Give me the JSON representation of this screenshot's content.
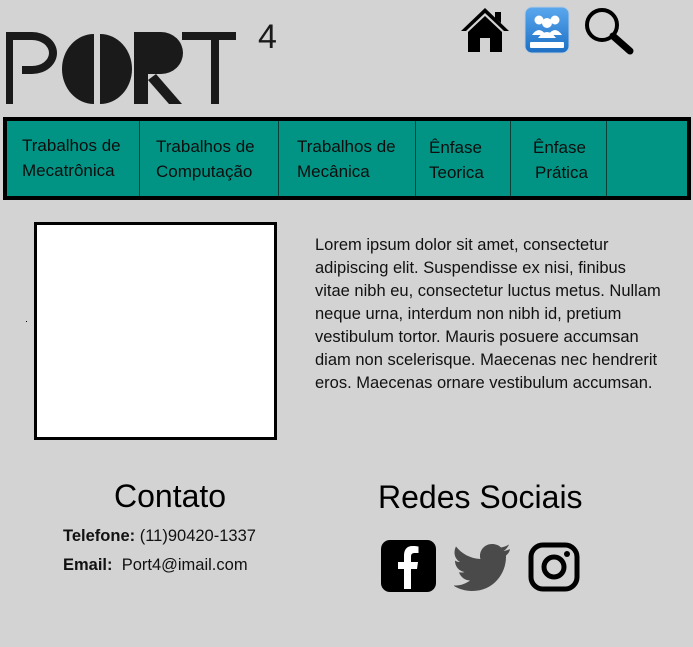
{
  "header": {
    "logo_text": "PORT",
    "logo_sup": "4",
    "icons": [
      "home-icon",
      "community-icon",
      "search-icon"
    ]
  },
  "nav": {
    "items": [
      {
        "line1": "Trabalhos de",
        "line2": "Mecatrônica"
      },
      {
        "line1": "Trabalhos de",
        "line2": "Computação"
      },
      {
        "line1": "Trabalhos de",
        "line2": "Mecânica"
      },
      {
        "line1": "Ênfase",
        "line2": "Teorica"
      },
      {
        "line1": "Ênfase",
        "line2": "Prática"
      }
    ]
  },
  "main": {
    "text": "Lorem ipsum dolor sit amet, consectetur adipiscing elit. Suspendisse ex nisi, finibus vitae nibh eu, consectetur luctus metus. Nullam neque urna, interdum non nibh id, pretium vestibulum tortor. Mauris posuere accumsan diam non scelerisque. Maecenas nec hendrerit eros. Maecenas ornare vestibulum accumsan."
  },
  "contact": {
    "title": "Contato",
    "phone_label": "Telefone:",
    "phone_value": "(11)90420-1337",
    "email_label": "Email:",
    "email_value": "Port4@imail.com"
  },
  "social": {
    "title": "Redes Sociais",
    "icons": [
      "facebook-icon",
      "twitter-icon",
      "instagram-icon"
    ]
  },
  "colors": {
    "background": "#d3d3d3",
    "nav": "#019484"
  }
}
